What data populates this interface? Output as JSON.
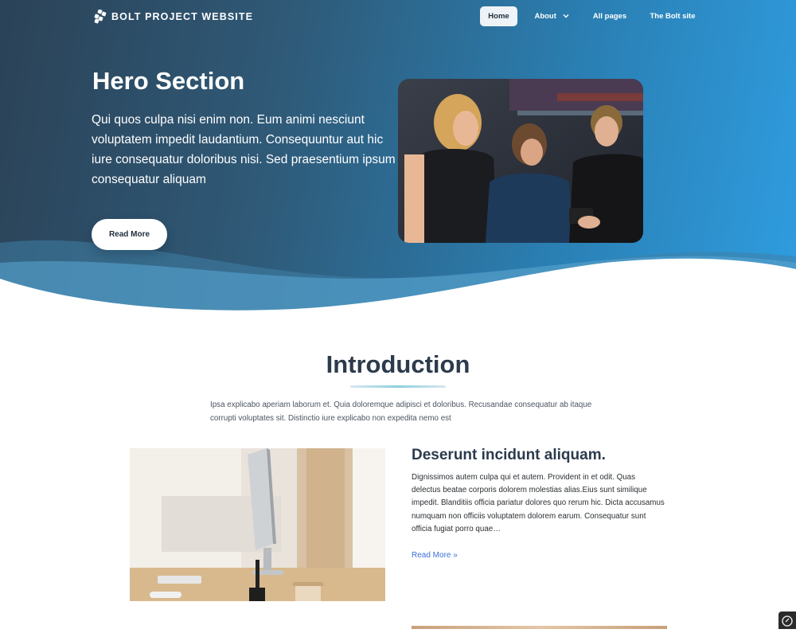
{
  "colors": {
    "hero_start": "#2b4257",
    "hero_end": "#2f9de0",
    "heading": "#2c3b4c",
    "link": "#3b6fd6",
    "accent_line": "#8fd0e0"
  },
  "nav": {
    "brand": "BOLT PROJECT WEBSITE",
    "brand_icon": "bolt-logo-icon",
    "items": [
      {
        "label": "Home",
        "active": true
      },
      {
        "label": "About",
        "dropdown": true
      },
      {
        "label": "All pages"
      },
      {
        "label": "The Bolt site"
      }
    ]
  },
  "hero": {
    "title": "Hero Section",
    "text": "Qui quos culpa nisi enim non. Eum animi nesciunt voluptatem impedit laudantium. Consequuntur aut hic iure consequatur doloribus nisi. Sed praesentium ipsum consequatur aliquam",
    "button": "Read More"
  },
  "intro": {
    "title": "Introduction",
    "text": "Ipsa explicabo aperiam laborum et. Quia doloremque adipisci et doloribus. Recusandae consequatur ab itaque corrupti voluptates sit. Distinctio iure explicabo non expedita nemo est"
  },
  "article": {
    "title": "Deserunt incidunt aliquam.",
    "text": "Dignissimos autem culpa qui et autem. Provident in et odit. Quas delectus beatae corporis dolorem molestias alias.Eius sunt similique impedit. Blanditiis officia pariatur dolores quo rerum hic. Dicta accusamus numquam non officiis voluptatem dolorem earum. Consequatur sunt officia fugiat porro quae…",
    "link": "Read More »"
  }
}
